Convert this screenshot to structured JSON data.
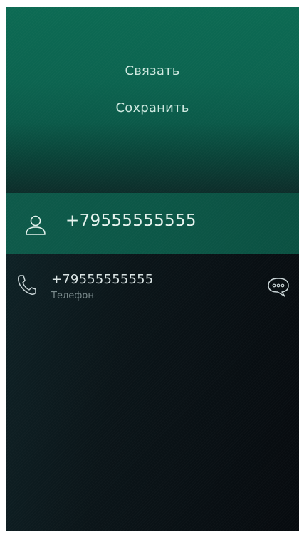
{
  "pulley_menu": {
    "items": [
      {
        "label": "Связать"
      },
      {
        "label": "Сохранить"
      }
    ]
  },
  "header": {
    "avatar_icon": "person-outline-icon",
    "number": "+79555555555"
  },
  "detail": {
    "phone_icon": "phone-handset-icon",
    "number": "+79555555555",
    "type_label": "Телефон",
    "message_icon": "message-bubble-icon"
  },
  "colors": {
    "menu_bg_top": "#0c6a53",
    "header_bg": "#0c5747",
    "page_bg": "#0b1519",
    "menu_text": "#cfe9e0",
    "secondary_text": "#7a8a8c"
  }
}
